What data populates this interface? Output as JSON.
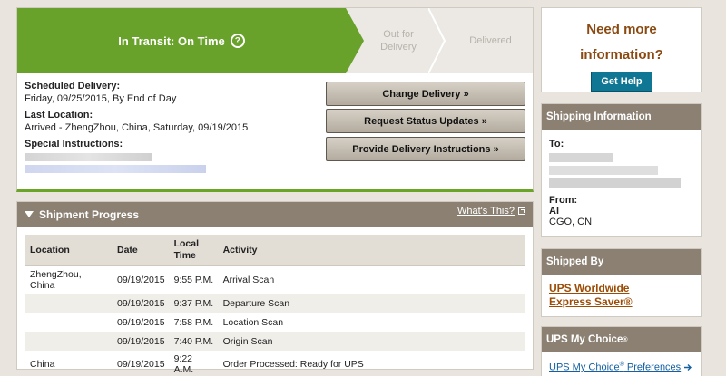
{
  "status": {
    "active_step": "In Transit: On Time",
    "help_icon_glyph": "?",
    "step_out": "Out for Delivery",
    "step_delivered": "Delivered"
  },
  "details": {
    "scheduled_label": "Scheduled Delivery:",
    "scheduled_value": "Friday, 09/25/2015, By End of Day",
    "last_location_label": "Last Location:",
    "last_location_value": "Arrived - ZhengZhou, China, Saturday, 09/19/2015",
    "special_label": "Special Instructions:"
  },
  "actions": {
    "change_delivery": "Change Delivery »",
    "request_updates": "Request Status Updates »",
    "provide_instructions": "Provide Delivery Instructions »"
  },
  "progress": {
    "title": "Shipment Progress",
    "whats_this": "What's This?",
    "columns": [
      "Location",
      "Date",
      "Local Time",
      "Activity"
    ],
    "rows": [
      {
        "location": "ZhengZhou, China",
        "date": "09/19/2015",
        "time": "9:55 P.M.",
        "activity": "Arrival Scan"
      },
      {
        "location": "",
        "date": "09/19/2015",
        "time": "9:37 P.M.",
        "activity": "Departure Scan"
      },
      {
        "location": "",
        "date": "09/19/2015",
        "time": "7:58 P.M.",
        "activity": "Location Scan"
      },
      {
        "location": "",
        "date": "09/19/2015",
        "time": "7:40 P.M.",
        "activity": "Origin Scan"
      },
      {
        "location": "China",
        "date": "09/19/2015",
        "time": "9:22 A.M.",
        "activity": "Order Processed: Ready for UPS"
      }
    ]
  },
  "sidebar": {
    "need_info_line1": "Need more",
    "need_info_line2": "information?",
    "get_help": "Get Help",
    "shipping_info_title": "Shipping Information",
    "to_label": "To:",
    "from_label": "From:",
    "from_name": "Al",
    "from_location": "CGO, CN",
    "shipped_by_title": "Shipped By",
    "ups_service_line1": "UPS Worldwide",
    "ups_service_line2": "Express Saver®",
    "my_choice_title": "UPS My Choice",
    "my_choice_reg": "®",
    "my_choice_link": "UPS My Choice",
    "my_choice_link_reg": "®",
    "my_choice_link_suffix": " Preferences"
  },
  "colors": {
    "accent_green": "#68a22a",
    "panel_header": "#8b8072",
    "link_brown": "#9c4c06",
    "help_button": "#0f7794",
    "link_blue": "#1560a0"
  }
}
